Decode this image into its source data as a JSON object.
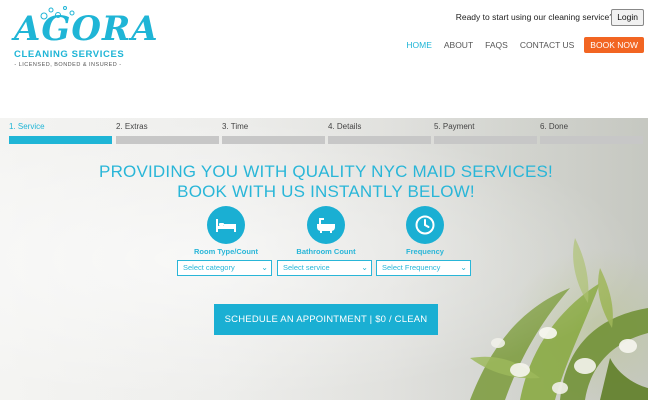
{
  "logo": {
    "title": "AGORA",
    "subtitle": "CLEANING SERVICES",
    "tagline": "- LICENSED, BONDED & INSURED -"
  },
  "header": {
    "ready_text": "Ready to start using our cleaning service?",
    "login_label": "Login"
  },
  "nav": {
    "items": [
      {
        "label": "HOME",
        "active": true
      },
      {
        "label": "ABOUT"
      },
      {
        "label": "FAQS"
      },
      {
        "label": "CONTACT US"
      }
    ],
    "book_now": "BOOK NOW"
  },
  "steps": [
    {
      "label": "1. Service",
      "active": true
    },
    {
      "label": "2. Extras"
    },
    {
      "label": "3. Time"
    },
    {
      "label": "4. Details"
    },
    {
      "label": "5. Payment"
    },
    {
      "label": "6. Done"
    }
  ],
  "hero": {
    "headline_1": "PROVIDING YOU WITH QUALITY NYC MAID SERVICES!",
    "headline_2": "BOOK WITH US INSTANTLY BELOW!"
  },
  "options": [
    {
      "icon": "bed-icon",
      "label": "Room Type/Count",
      "select": "Select category"
    },
    {
      "icon": "bathtub-icon",
      "label": "Bathroom Count",
      "select": "Select service"
    },
    {
      "icon": "clock-icon",
      "label": "Frequency",
      "select": "Select Frequency"
    }
  ],
  "cta": {
    "label": "SCHEDULE AN APPOINTMENT | $0 / CLEAN"
  },
  "colors": {
    "accent": "#1fb5d6",
    "book_now": "#f26522",
    "step_inactive": "#c7c7c7"
  }
}
